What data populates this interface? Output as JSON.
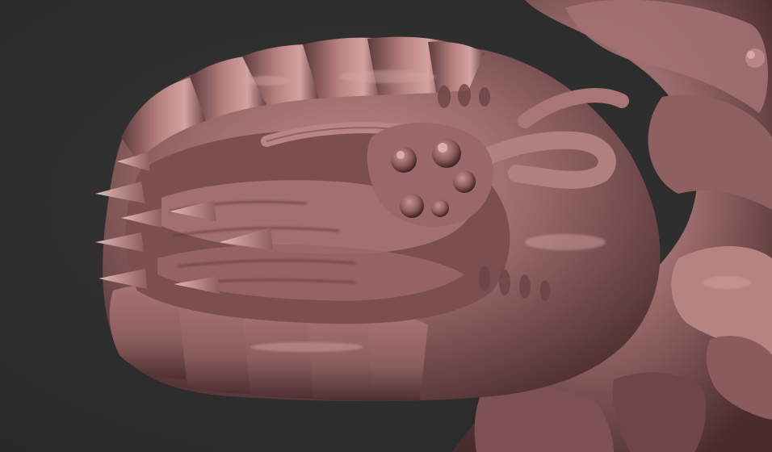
{
  "viewport": {
    "background_color": "#2e2e2e",
    "material_base_color": "#9a6a6a",
    "material_shadow_color": "#4a2c2e",
    "material_highlight_color": "#d7aaa8"
  },
  "subject": {
    "icon": "sculpt-render"
  }
}
